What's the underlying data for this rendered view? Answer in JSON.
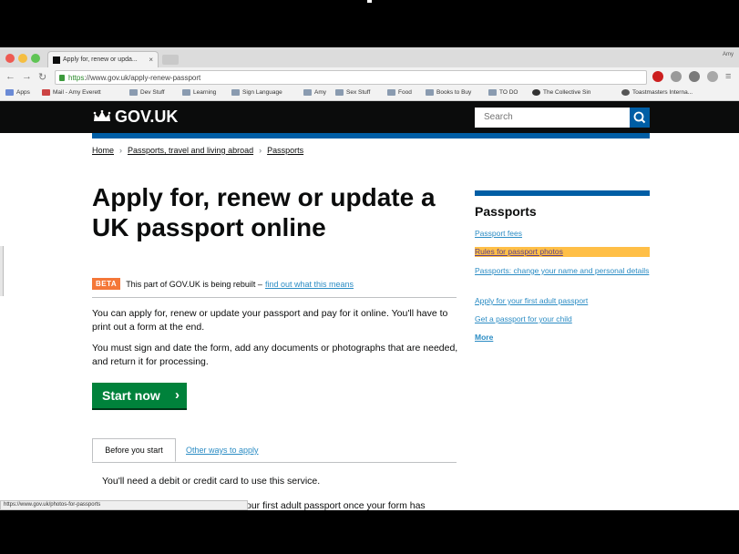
{
  "browser": {
    "tab_title": "Apply for, renew or upda...",
    "tab_close": "×",
    "user_label": "Amy",
    "url_https": "https",
    "url_rest": "://www.gov.uk/apply-renew-passport",
    "bookmarks": [
      "Apps",
      "Mail - Amy Everett",
      "Dev Stuff",
      "Learning",
      "Sign Language",
      "Amy",
      "Sex Stuff",
      "Food",
      "Books to Buy",
      "TO DO",
      "The Collective Sin",
      "Toastmasters Interna..."
    ],
    "status_url": "https://www.gov.uk/photos-for-passports"
  },
  "header": {
    "logo": "GOV.UK",
    "search_placeholder": "Search"
  },
  "breadcrumb": [
    "Home",
    "Passports, travel and living abroad",
    "Passports"
  ],
  "page": {
    "title": "Apply for, renew or update a UK passport online",
    "beta_tag": "BETA",
    "beta_text": "This part of GOV.UK is being rebuilt –",
    "beta_link": "find out what this means",
    "para1": "You can apply for, renew or update your passport and pay for it online. You'll have to print out a form at the end.",
    "para2": "You must sign and date the form, add any documents or photographs that are needed, and return it for processing.",
    "start_button": "Start now",
    "start_arrow": "›",
    "tabs": [
      "Before you start",
      "Other ways to apply"
    ],
    "card_line1": "You'll need a debit or credit card to use this service.",
    "card_line2": "our first adult passport once your form has"
  },
  "sidebar": {
    "title": "Passports",
    "links": [
      "Passport fees",
      "Rules for passport photos",
      "Passports: change your name and personal details",
      "Apply for your first adult passport",
      "Get a passport for your child"
    ],
    "more": "More"
  },
  "colors": {
    "gov_black": "#0b0c0c",
    "gov_blue": "#005ea5",
    "link_blue": "#2b8cc4",
    "start_green": "#00823b",
    "beta_orange": "#f47738",
    "highlight": "#ffbf47"
  }
}
